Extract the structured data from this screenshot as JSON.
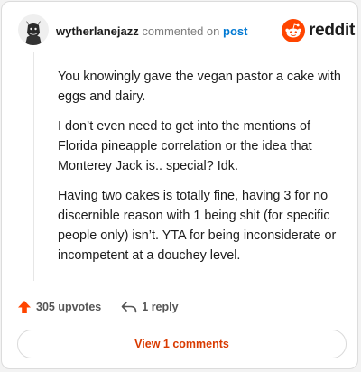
{
  "comment": {
    "username": "wytherlanejazz",
    "action_text": "commented on",
    "post_link": "post",
    "brand": "reddit",
    "paragraphs": [
      "You knowingly gave the vegan pastor a cake with eggs and dairy.",
      "I don’t even need to get into the mentions of Florida pineapple correlation or the idea that Monterey Jack is.. special? Idk.",
      "Having two cakes is totally fine, having 3 for no discernible reason with 1 being shit (for specific people only) isn’t. YTA for being inconsiderate or incompetent at a douchey level."
    ]
  },
  "actions": {
    "upvotes": "305 upvotes",
    "replies": "1 reply"
  },
  "view_button": "View 1 comments",
  "colors": {
    "accent": "#ff4500",
    "link": "#0079d3",
    "button_text": "#d93a00"
  },
  "icons": [
    "avatar-image",
    "reddit-logo-icon",
    "upvote-arrow-icon",
    "reply-icon"
  ]
}
